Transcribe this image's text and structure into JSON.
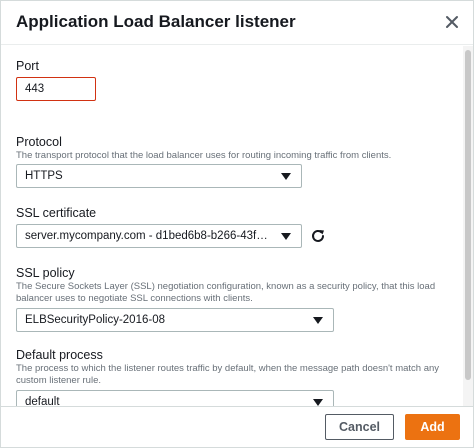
{
  "dialog": {
    "title": "Application Load Balancer listener",
    "close_icon": "close-icon"
  },
  "port": {
    "label": "Port",
    "value": "443"
  },
  "protocol": {
    "label": "Protocol",
    "description": "The transport protocol that the load balancer uses for routing incoming traffic from clients.",
    "selected": "HTTPS"
  },
  "ssl_certificate": {
    "label": "SSL certificate",
    "selected": "server.mycompany.com - d1bed6b8-b266-43f9-...",
    "refresh_icon": "refresh-icon"
  },
  "ssl_policy": {
    "label": "SSL policy",
    "description": "The Secure Sockets Layer (SSL) negotiation configuration, known as a security policy, that this load balancer uses to negotiate SSL connections with clients.",
    "selected": "ELBSecurityPolicy-2016-08"
  },
  "default_process": {
    "label": "Default process",
    "description": "The process to which the listener routes traffic by default, when the message path doesn't match any custom listener rule.",
    "selected": "default"
  },
  "footer": {
    "cancel_label": "Cancel",
    "add_label": "Add"
  },
  "colors": {
    "primary": "#ec7211",
    "error_border": "#d13212",
    "text": "#16191f",
    "secondary_text": "#687078"
  }
}
